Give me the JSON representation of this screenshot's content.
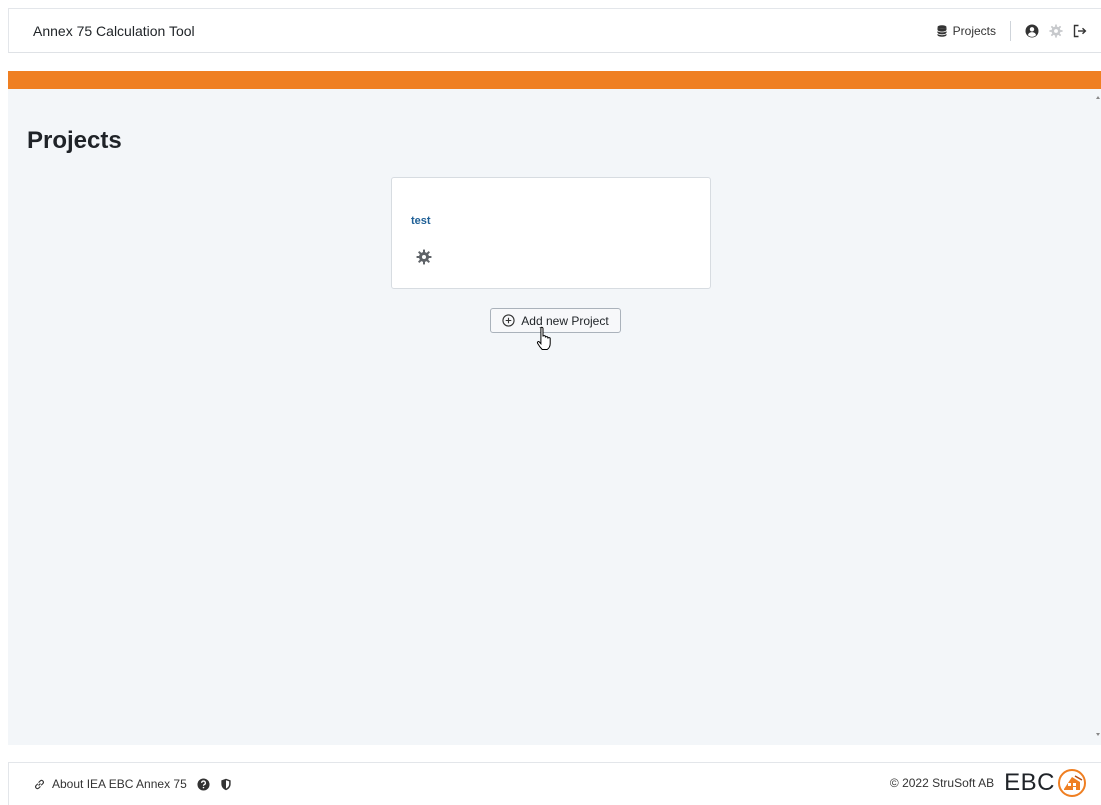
{
  "header": {
    "app_title": "Annex 75 Calculation Tool",
    "nav_projects_label": "Projects",
    "icons": [
      "database-icon",
      "user-icon",
      "gear-icon",
      "logout-icon"
    ]
  },
  "colors": {
    "accent": "#ef7f22",
    "page_background": "#f3f6f9",
    "project_link": "#1e5f96"
  },
  "main": {
    "page_title": "Projects",
    "projects": [
      {
        "name": "test"
      }
    ],
    "add_button_label": "Add new Project"
  },
  "footer": {
    "about_label": "About IEA EBC Annex 75",
    "copyright": "© 2022 StruSoft AB",
    "logo_text": "EBC"
  }
}
